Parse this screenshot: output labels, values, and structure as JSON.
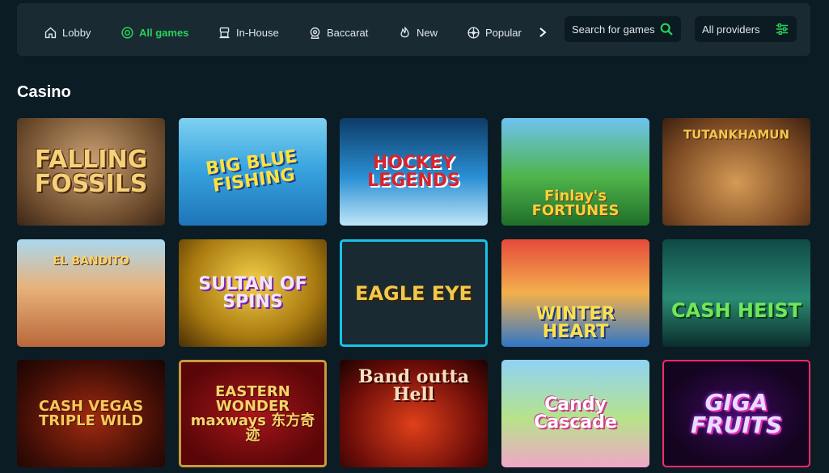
{
  "nav": {
    "items": [
      {
        "label": "Lobby",
        "icon": "home-icon",
        "active": false
      },
      {
        "label": "All games",
        "icon": "all-games-icon",
        "active": true
      },
      {
        "label": "In-House",
        "icon": "in-house-icon",
        "active": false
      },
      {
        "label": "Baccarat",
        "icon": "baccarat-icon",
        "active": false
      },
      {
        "label": "New",
        "icon": "flame-icon",
        "active": false
      },
      {
        "label": "Popular",
        "icon": "popular-icon",
        "active": false
      }
    ],
    "next_icon": "chevron-right-icon",
    "search_placeholder": "Search for games",
    "search_icon": "search-icon",
    "providers_label": "All providers",
    "filter_icon": "filter-icon"
  },
  "section_title": "Casino",
  "accent_color": "#27d158",
  "games": [
    {
      "title": "FALLING FOSSILS"
    },
    {
      "title": "BIG BLUE FISHING"
    },
    {
      "title": "HOCKEY LEGENDS"
    },
    {
      "title": "Finlay's FORTUNES"
    },
    {
      "title": "TUTANKHAMUN"
    },
    {
      "title": "EL BANDITO"
    },
    {
      "title": "SULTAN OF SPINS"
    },
    {
      "title": "EAGLE EYE"
    },
    {
      "title": "WINTER HEART"
    },
    {
      "title": "CASH HEIST"
    },
    {
      "title": "CASH VEGAS TRIPLE WILD"
    },
    {
      "title": "EASTERN WONDER maxways 东方奇迹"
    },
    {
      "title": "Band outta Hell"
    },
    {
      "title": "Candy Cascade"
    },
    {
      "title": "GIGA FRUITS"
    }
  ]
}
